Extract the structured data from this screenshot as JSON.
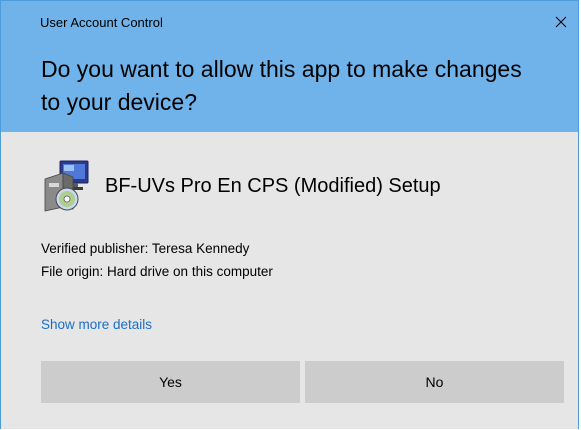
{
  "window": {
    "title": "User Account Control",
    "close_icon": "close-icon"
  },
  "header": {
    "question": "Do you want to allow this app to make changes to your device?"
  },
  "app": {
    "icon": "installer-icon",
    "name": "BF-UVs Pro En CPS (Modified) Setup"
  },
  "details": {
    "publisher": "Verified publisher: Teresa Kennedy",
    "origin": "File origin: Hard drive on this computer",
    "show_more": "Show more details"
  },
  "buttons": {
    "yes": "Yes",
    "no": "No"
  },
  "colors": {
    "header_bg": "#6fb3ea",
    "body_bg": "#e6e6e6",
    "button_bg": "#cccccc",
    "link": "#1a6ec9"
  }
}
